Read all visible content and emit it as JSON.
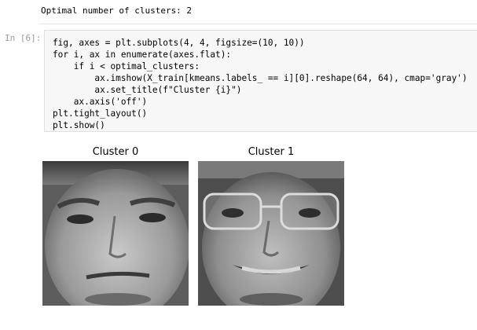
{
  "previous_output": {
    "text": "Optimal number of clusters: 2"
  },
  "cell": {
    "prompt": "In [6]:",
    "code_lines": [
      "fig, axes = plt.subplots(4, 4, figsize=(10, 10))",
      "for i, ax in enumerate(axes.flat):",
      "    if i < optimal_clusters:",
      "        ax.imshow(X_train[kmeans.labels_ == i][0].reshape(64, 64), cmap='gray')",
      "        ax.set_title(f\"Cluster {i}\")",
      "    ax.axis('off')",
      "plt.tight_layout()",
      "plt.show()"
    ]
  },
  "output": {
    "panels": [
      {
        "title": "Cluster 0",
        "image": "grayscale-face-image"
      },
      {
        "title": "Cluster 1",
        "image": "grayscale-face-with-glasses-image"
      }
    ]
  }
}
